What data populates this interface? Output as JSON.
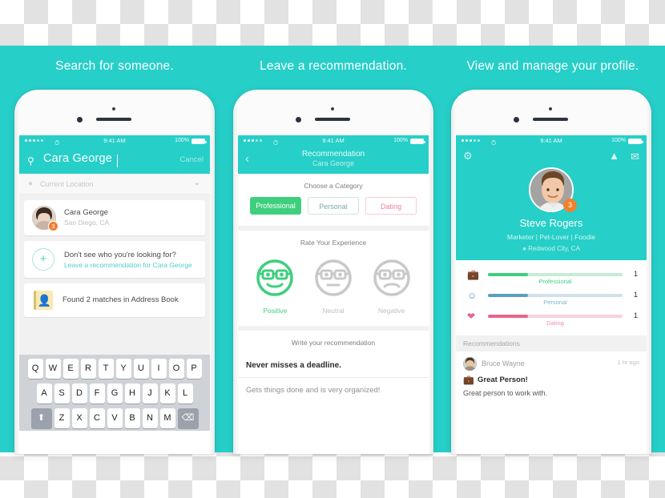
{
  "theme": {
    "teal": "#26cfc8",
    "green": "#3ecf7e",
    "orange": "#f0812f",
    "pink": "#ef7f9e",
    "blue": "#5b9fc0"
  },
  "headlines": {
    "one": "Search for someone.",
    "two": "Leave a recommendation.",
    "three": "View and manage your profile."
  },
  "status_bar": {
    "time": "9:41 AM",
    "battery": "100%",
    "wifi_icon": "wifi-icon",
    "carrier_dots": 5
  },
  "phone1": {
    "search": {
      "value": "Cara George",
      "placeholder": "Search",
      "cancel": "Cancel",
      "icon": "search-icon"
    },
    "location": {
      "value": "Current Location",
      "icon": "location-pin-icon",
      "chevron": "chevron-down-icon"
    },
    "result": {
      "name": "Cara George",
      "city": "San Diego, CA",
      "badge": "3"
    },
    "prompt": {
      "question": "Don't see who you're looking for?",
      "link": "Leave a recommendation for Cara George",
      "icon": "plus-circle-icon"
    },
    "address_book": {
      "label": "Found 2 matches in Address Book",
      "icon": "address-book-icon"
    },
    "keyboard": {
      "row1": [
        "Q",
        "W",
        "E",
        "R",
        "T",
        "Y",
        "U",
        "I",
        "O",
        "P"
      ],
      "row2": [
        "A",
        "S",
        "D",
        "F",
        "G",
        "H",
        "J",
        "K",
        "L"
      ],
      "row3": [
        "Z",
        "X",
        "C",
        "V",
        "B",
        "N",
        "M"
      ],
      "shift": "⬆",
      "backspace": "⌫"
    }
  },
  "phone2": {
    "nav": {
      "back": "‹",
      "title": "Recommendation",
      "subtitle": "Cara George"
    },
    "category": {
      "heading": "Choose a Category",
      "options": [
        {
          "label": "Professional",
          "selected": true
        },
        {
          "label": "Personal",
          "selected": false
        },
        {
          "label": "Dating",
          "selected": false
        }
      ]
    },
    "rating": {
      "heading": "Rate Your Experience",
      "options": [
        {
          "label": "Positive",
          "selected": true,
          "icon": "smiling-nerd-face-icon"
        },
        {
          "label": "Neutral",
          "selected": false,
          "icon": "neutral-nerd-face-icon"
        },
        {
          "label": "Negative",
          "selected": false,
          "icon": "frowning-nerd-face-icon"
        }
      ]
    },
    "write": {
      "heading": "Write your recommendation",
      "title": "Never misses a deadline.",
      "body": "Gets things done and is very organized!"
    }
  },
  "phone3": {
    "actions": {
      "settings": "gear-icon",
      "share": "share-icon",
      "mail": "mail-icon"
    },
    "profile": {
      "name": "Steve Rogers",
      "tags": "Marketer | Pet-Lover | Foodie",
      "location": "Redwood City, CA",
      "location_icon": "location-pin-icon",
      "badge": "3"
    },
    "stats": [
      {
        "label": "Professional",
        "count": "1",
        "fill_pct": 30,
        "color": "#3ecf7e",
        "track": "#c6ecd6",
        "icon": "briefcase-icon"
      },
      {
        "label": "Personal",
        "count": "1",
        "fill_pct": 30,
        "color": "#5b9fc0",
        "track": "#cfe2ec",
        "icon": "person-circle-icon"
      },
      {
        "label": "Dating",
        "count": "1",
        "fill_pct": 30,
        "color": "#e8658c",
        "track": "#f7d3de",
        "icon": "hearts-icon"
      }
    ],
    "recommendations": {
      "heading": "Recommendations",
      "items": [
        {
          "author": "Bruce Wayne",
          "time": "1 hr ago",
          "title": "Great Person!",
          "body": "Great person to work with.",
          "icon": "briefcase-icon"
        }
      ]
    }
  }
}
